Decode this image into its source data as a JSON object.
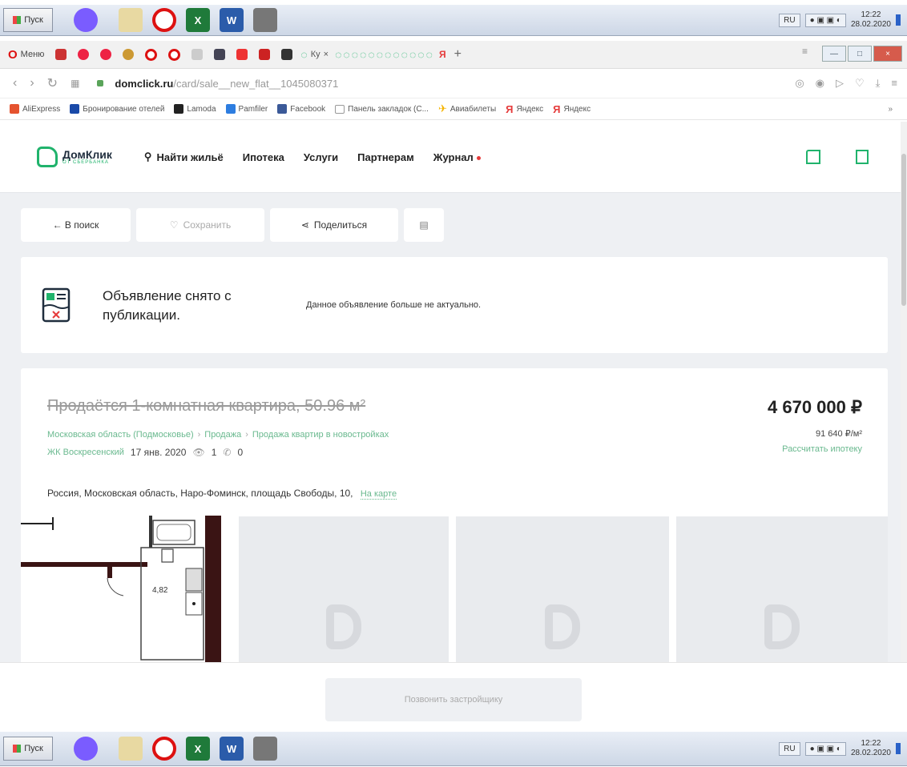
{
  "taskbar": {
    "start_label": "Пуск",
    "lang": "RU",
    "time": "12:22",
    "date": "28.02.2020"
  },
  "browser": {
    "menu_label": "Меню",
    "tab_label": "Ку",
    "url_domain": "domclick.ru",
    "url_path": "/card/sale__new_flat__1045080371",
    "bookmarks": [
      {
        "label": "AliExpress",
        "color": "#e5532f"
      },
      {
        "label": "Бронирование отелей",
        "color": "#1a4aa8"
      },
      {
        "label": "Lamoda",
        "color": "#222222"
      },
      {
        "label": "Pamfiler",
        "color": "#2d7de0"
      },
      {
        "label": "Facebook",
        "color": "#3b5998"
      },
      {
        "label": "Панель закладок (С...",
        "color": "#999999"
      },
      {
        "label": "Авиабилеты",
        "color": "#f5b400"
      },
      {
        "label": "Яндекс",
        "color": "#e53b3b"
      },
      {
        "label": "Яндекс",
        "color": "#e53b3b"
      }
    ]
  },
  "site": {
    "logo_name": "ДомКлик",
    "logo_sub": "ОТ СБЕРБАНКА",
    "nav": {
      "search": "Найти жильё",
      "mortgage": "Ипотека",
      "services": "Услуги",
      "partners": "Партнерам",
      "journal": "Журнал"
    }
  },
  "toolbar": {
    "back": "← В поиск",
    "save": "Сохранить",
    "share": "Поделиться"
  },
  "notice": {
    "title": "Объявление снято с публикации.",
    "text": "Данное объявление больше не актуально."
  },
  "listing": {
    "title": "Продаётся 1-комнатная квартира, 50.96 м²",
    "crumbs": [
      "Московская область (Подмосковье)",
      "Продажа",
      "Продажа квартир в новостройках"
    ],
    "complex": "ЖК Воскресенский",
    "date": "17 янв. 2020",
    "views": "1",
    "calls": "0",
    "address": "Россия, Московская область, Наро-Фоминск, площадь Свободы, 10,",
    "map_link": "На карте",
    "price": "4 670 000 ₽",
    "price_per_m2": "91 640 ₽/м²",
    "mortgage_link": "Рассчитать ипотеку",
    "plan_area_label": "4,82"
  },
  "footer": {
    "call_button": "Позвонить застройщику"
  },
  "colors": {
    "brand_green": "#20b36c",
    "link_green": "#6ab98f",
    "page_bg": "#eef0f3"
  }
}
